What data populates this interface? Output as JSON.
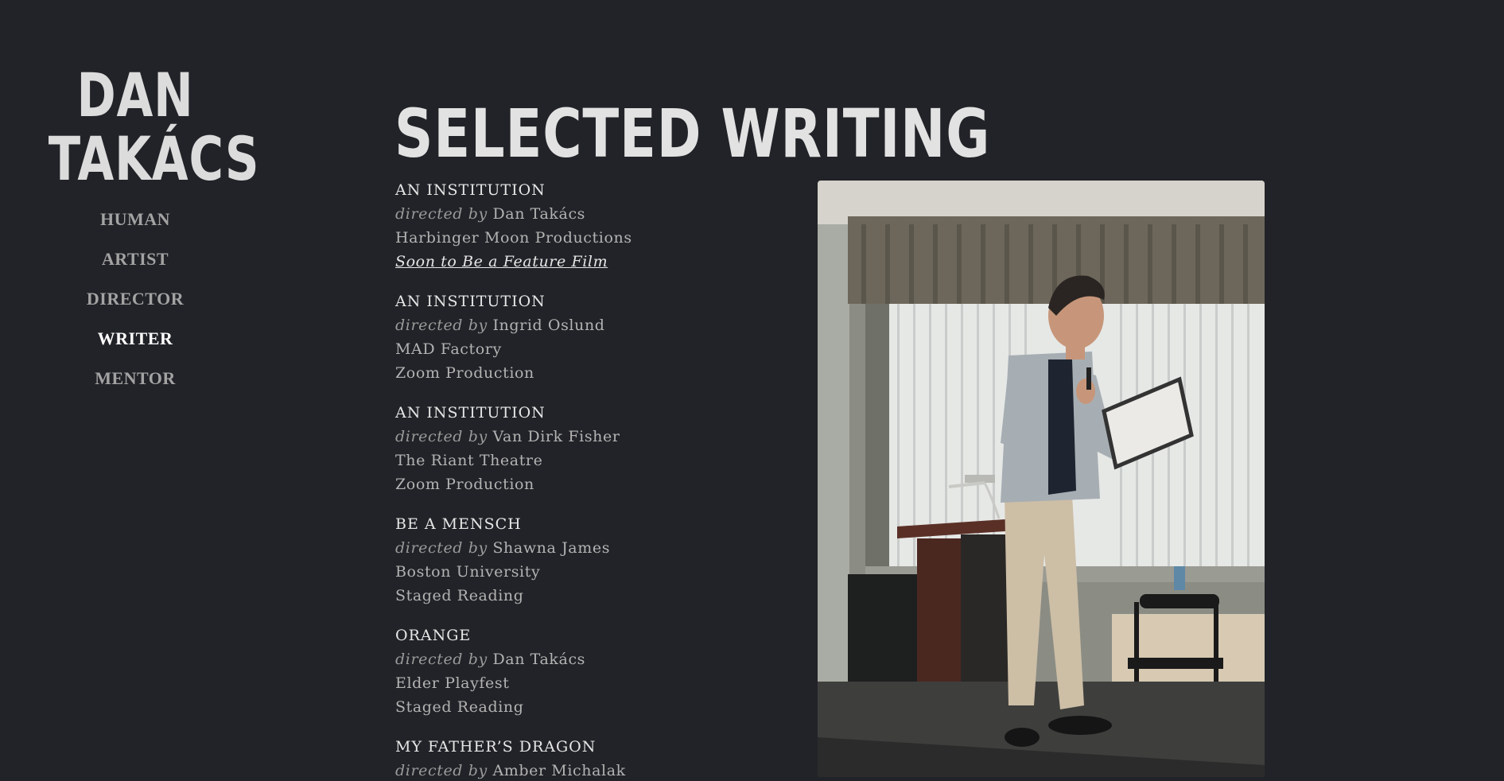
{
  "site": {
    "title_line1": "DAN",
    "title_line2": "TAKÁCS"
  },
  "nav": {
    "items": [
      {
        "label": "HUMAN",
        "active": false
      },
      {
        "label": "ARTIST",
        "active": false
      },
      {
        "label": "DIRECTOR",
        "active": false
      },
      {
        "label": "WRITER",
        "active": true
      },
      {
        "label": "MENTOR",
        "active": false
      }
    ]
  },
  "main": {
    "heading": "SELECTED WRITING",
    "directed_by_label": "directed by",
    "works": [
      {
        "title": "AN INSTITUTION",
        "director": "Dan Takács",
        "company": "Harbinger Moon Productions",
        "note": "Soon to Be a Feature Film",
        "note_is_link": true
      },
      {
        "title": "AN INSTITUTION",
        "director": "Ingrid Oslund",
        "company": "MAD Factory",
        "note": "Zoom Production",
        "note_is_link": false
      },
      {
        "title": "AN INSTITUTION",
        "director": "Van Dirk Fisher",
        "company": "The Riant Theatre",
        "note": "Zoom Production",
        "note_is_link": false
      },
      {
        "title": "BE A MENSCH",
        "director": "Shawna James",
        "company": "Boston University",
        "note": "Staged Reading",
        "note_is_link": false
      },
      {
        "title": "ORANGE",
        "director": "Dan Takács",
        "company": "Elder Playfest",
        "note": "Staged Reading",
        "note_is_link": false
      },
      {
        "title": "MY FATHER’S DRAGON",
        "director": "Amber Michalak",
        "company": "",
        "note": "",
        "note_is_link": false
      }
    ],
    "photo": {
      "subject": "man-reading-script-at-podium"
    }
  },
  "colors": {
    "background": "#212328",
    "heading": "#e2e2e2",
    "nav_inactive": "#a3a3a3",
    "nav_active": "#ffffff"
  }
}
